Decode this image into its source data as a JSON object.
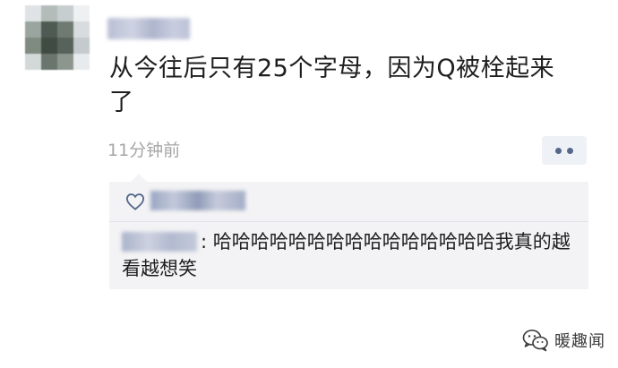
{
  "post": {
    "text_line1": "从今往后只有25个字母，因为Q被栓起来",
    "text_line2": "了",
    "timestamp": "11分钟前"
  },
  "comment": {
    "separator": ":",
    "text": "哈哈哈哈哈哈哈哈哈哈哈哈哈哈哈我真的越看越想笑"
  },
  "watermark": {
    "label": "暖趣闻"
  },
  "icons": {
    "like": "heart-icon",
    "more": "more-dots-icon",
    "watermark": "wechat-icon"
  },
  "colors": {
    "text": "#1e1e1e",
    "timestamp": "#a6a6a6",
    "comment_bg": "#f3f3f5",
    "more_button_bg": "#eef1f6",
    "more_dots": "#55688a"
  }
}
